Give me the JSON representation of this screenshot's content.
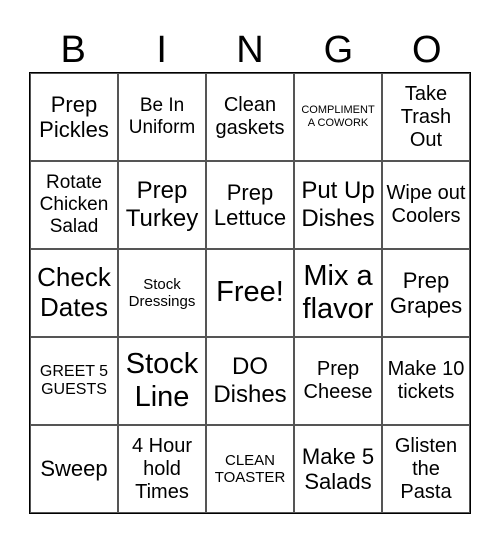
{
  "header": [
    "B",
    "I",
    "N",
    "G",
    "O"
  ],
  "cells": [
    "Prep Pickles",
    "Be In Uniform",
    "Clean gaskets",
    "COMPLIMENT A COWORK",
    "Take Trash Out",
    "Rotate Chicken Salad",
    "Prep Turkey",
    "Prep Lettuce",
    "Put Up Dishes",
    "Wipe out Coolers",
    "Check Dates",
    "Stock Dressings",
    "Free!",
    "Mix a flavor",
    "Prep Grapes",
    "GREET 5 GUESTS",
    "Stock Line",
    "DO Dishes",
    "Prep Cheese",
    "Make 10 tickets",
    "Sweep",
    "4 Hour hold Times",
    "CLEAN TOASTER",
    "Make 5 Salads",
    "Glisten the Pasta"
  ]
}
